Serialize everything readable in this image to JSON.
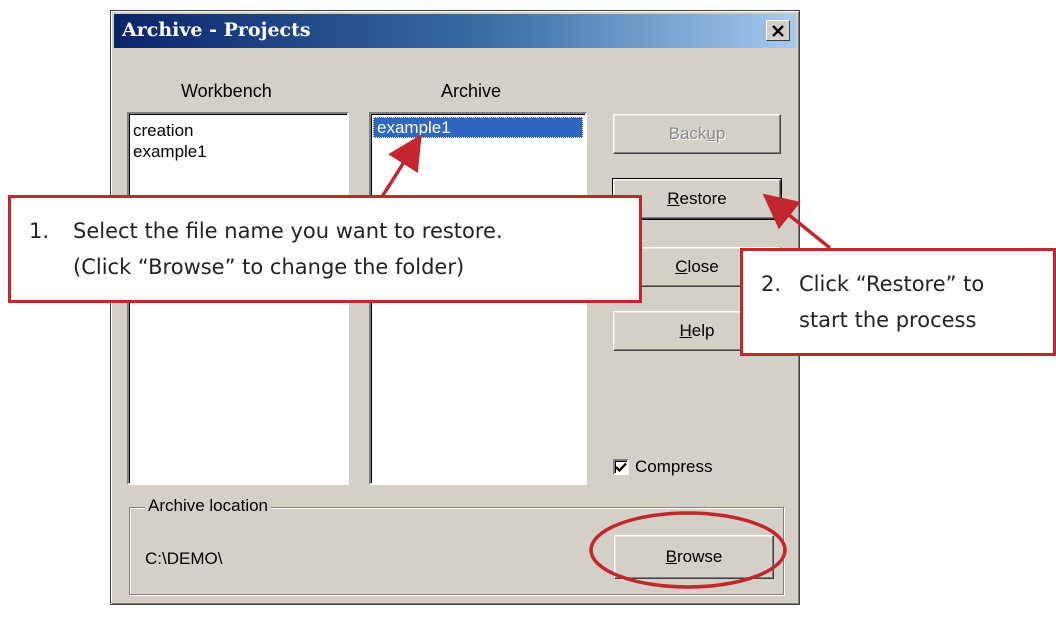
{
  "window": {
    "title": "Archive - Projects",
    "close_icon": "close-x-icon"
  },
  "workbench": {
    "label": "Workbench",
    "items": [
      "creation",
      "example1"
    ]
  },
  "archive": {
    "label": "Archive",
    "items": [
      "example1"
    ],
    "selected_index": 0
  },
  "buttons": {
    "backup": {
      "pre": "Back",
      "u": "u",
      "post": "p",
      "enabled": false
    },
    "restore": {
      "pre": "",
      "u": "R",
      "post": "estore"
    },
    "close": {
      "pre": "",
      "u": "C",
      "post": "lose"
    },
    "help": {
      "pre": "",
      "u": "H",
      "post": "elp"
    },
    "browse": {
      "pre": "",
      "u": "B",
      "post": "rowse"
    }
  },
  "compress": {
    "label": "Compress",
    "checked": true
  },
  "location": {
    "group_label": "Archive location",
    "path": "C:\\DEMO\\"
  },
  "callouts": {
    "one": {
      "number": "1.",
      "line1": "Select the file name you want to restore.",
      "line2": "(Click “Browse” to change the folder)"
    },
    "two": {
      "number": "2.",
      "line1": "Click “Restore” to",
      "line2": "start the process"
    }
  },
  "colors": {
    "callout_border": "#c1272d",
    "selection": "#3066c0",
    "title_bar": "#0a246a",
    "dialog_bg": "#d4d0c8"
  }
}
